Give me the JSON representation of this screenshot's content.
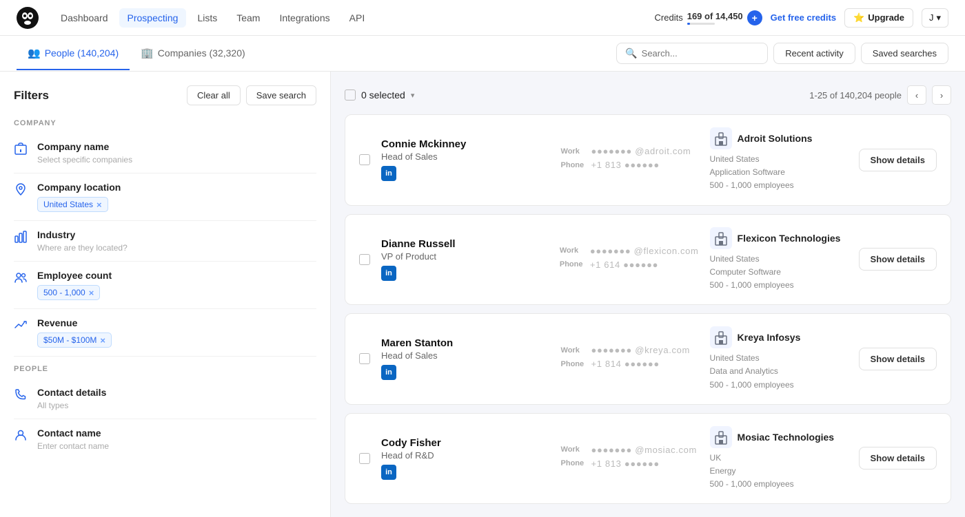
{
  "app": {
    "logo_alt": "Kaspr logo"
  },
  "topnav": {
    "links": [
      {
        "id": "dashboard",
        "label": "Dashboard",
        "active": false
      },
      {
        "id": "prospecting",
        "label": "Prospecting",
        "active": true
      },
      {
        "id": "lists",
        "label": "Lists",
        "active": false
      },
      {
        "id": "team",
        "label": "Team",
        "active": false
      },
      {
        "id": "integrations",
        "label": "Integrations",
        "active": false
      },
      {
        "id": "api",
        "label": "API",
        "active": false
      }
    ],
    "credits_label": "Credits",
    "credits_value": "169 of 14,450",
    "credits_plus": "+",
    "btn_free_credits": "Get free credits",
    "btn_upgrade": "Upgrade",
    "user_initial": "J"
  },
  "subnav": {
    "tabs": [
      {
        "id": "people",
        "label": "People (140,204)",
        "icon": "👥",
        "active": true
      },
      {
        "id": "companies",
        "label": "Companies (32,320)",
        "icon": "🏢",
        "active": false
      }
    ],
    "search_placeholder": "Search...",
    "btn_recent_activity": "Recent activity",
    "btn_saved_searches": "Saved searches"
  },
  "sidebar": {
    "title": "Filters",
    "btn_clear": "Clear all",
    "btn_save": "Save search",
    "section_company": "COMPANY",
    "section_people": "PEOPLE",
    "filters": [
      {
        "id": "company-name",
        "name": "Company name",
        "hint": "Select specific companies",
        "tags": [],
        "icon": "🏢",
        "section": "company"
      },
      {
        "id": "company-location",
        "name": "Company location",
        "hint": "",
        "tags": [
          "United States"
        ],
        "icon": "📍",
        "section": "company"
      },
      {
        "id": "industry",
        "name": "Industry",
        "hint": "Where are they located?",
        "tags": [],
        "icon": "🏭",
        "section": "company"
      },
      {
        "id": "employee-count",
        "name": "Employee count",
        "hint": "",
        "tags": [
          "500 - 1,000"
        ],
        "icon": "👥",
        "section": "company"
      },
      {
        "id": "revenue",
        "name": "Revenue",
        "hint": "",
        "tags": [
          "$50M - $100M"
        ],
        "icon": "📈",
        "section": "company"
      },
      {
        "id": "contact-details",
        "name": "Contact details",
        "hint": "All types",
        "tags": [],
        "icon": "📞",
        "section": "people"
      },
      {
        "id": "contact-name",
        "name": "Contact name",
        "hint": "Enter contact name",
        "tags": [],
        "icon": "👤",
        "section": "people"
      }
    ]
  },
  "content": {
    "selected_label": "0 selected",
    "pagination": "1-25 of 140,204 people",
    "results": [
      {
        "id": 1,
        "name": "Connie Mckinney",
        "title": "Head of Sales",
        "work_email": "●●●●●●● @adroit.com",
        "phone": "+1 813 ●●●●●●",
        "company_name": "Adroit Solutions",
        "company_country": "United States",
        "company_industry": "Application Software",
        "company_size": "500 - 1,000 employees",
        "has_linkedin": true
      },
      {
        "id": 2,
        "name": "Dianne Russell",
        "title": "VP of Product",
        "work_email": "●●●●●●● @flexicon.com",
        "phone": "+1 614 ●●●●●●",
        "company_name": "Flexicon Technologies",
        "company_country": "United States",
        "company_industry": "Computer Software",
        "company_size": "500 - 1,000 employees",
        "has_linkedin": true
      },
      {
        "id": 3,
        "name": "Maren Stanton",
        "title": "Head of Sales",
        "work_email": "●●●●●●● @kreya.com",
        "phone": "+1 814 ●●●●●●",
        "company_name": "Kreya Infosys",
        "company_country": "United States",
        "company_industry": "Data and Analytics",
        "company_size": "500 - 1,000 employees",
        "has_linkedin": true
      },
      {
        "id": 4,
        "name": "Cody Fisher",
        "title": "Head of R&D",
        "work_email": "●●●●●●● @mosiac.com",
        "phone": "+1 813 ●●●●●●",
        "company_name": "Mosiac Technologies",
        "company_country": "UK",
        "company_industry": "Energy",
        "company_size": "500 - 1,000 employees",
        "has_linkedin": true
      }
    ],
    "btn_show_details": "Show details"
  },
  "colors": {
    "accent": "#2563eb",
    "linkedin": "#0a66c2"
  }
}
